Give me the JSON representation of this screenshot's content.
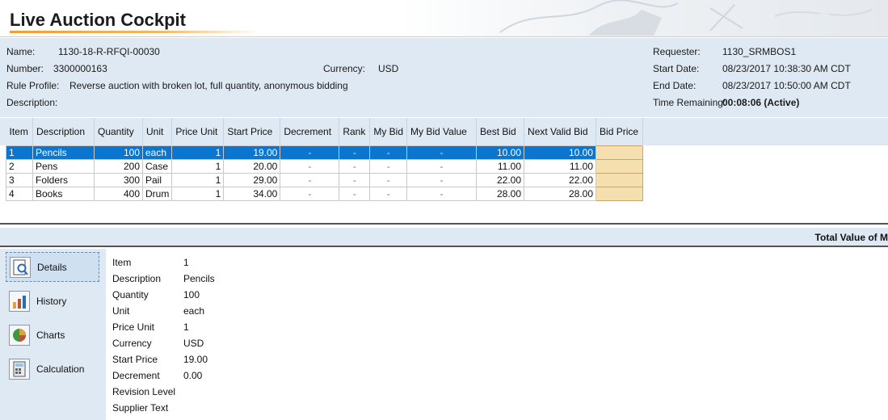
{
  "app": {
    "title": "Live Auction Cockpit"
  },
  "header": {
    "name_label": "Name:",
    "name_value": "1130-18-R-RFQI-00030",
    "number_label": "Number:",
    "number_value": "3300000163",
    "currency_label": "Currency:",
    "currency_value": "USD",
    "rule_label": "Rule Profile:",
    "rule_value": "Reverse auction with broken lot, full quantity, anonymous bidding",
    "description_label": "Description:",
    "requester_label": "Requester:",
    "requester_value": "1130_SRMBOS1",
    "start_label": "Start Date:",
    "start_value": "08/23/2017 10:38:30 AM CDT",
    "end_label": "End Date:",
    "end_value": "08/23/2017 10:50:00 AM CDT",
    "remaining_label": "Time Remaining:",
    "remaining_value": "00:08:06 (Active)"
  },
  "table": {
    "columns": [
      "Item",
      "Description",
      "Quantity",
      "Unit",
      "Price Unit",
      "Start Price",
      "Decrement",
      "Rank",
      "My Bid",
      "My Bid Value",
      "Best Bid",
      "Next Valid Bid",
      "Bid Price"
    ],
    "rows": [
      [
        "1",
        "Pencils",
        "100",
        "each",
        "1",
        "19.00",
        "-",
        "-",
        "-",
        "-",
        "10.00",
        "10.00",
        ""
      ],
      [
        "2",
        "Pens",
        "200",
        "Case",
        "1",
        "20.00",
        "-",
        "-",
        "-",
        "-",
        "11.00",
        "11.00",
        ""
      ],
      [
        "3",
        "Folders",
        "300",
        "Pail",
        "1",
        "29.00",
        "-",
        "-",
        "-",
        "-",
        "22.00",
        "22.00",
        ""
      ],
      [
        "4",
        "Books",
        "400",
        "Drum",
        "1",
        "34.00",
        "-",
        "-",
        "-",
        "-",
        "28.00",
        "28.00",
        ""
      ]
    ],
    "selected_row": 0
  },
  "total": {
    "label": "Total Value of M"
  },
  "nav": [
    {
      "label": "Details",
      "icon": "details-icon",
      "active": true
    },
    {
      "label": "History",
      "icon": "history-icon",
      "active": false
    },
    {
      "label": "Charts",
      "icon": "charts-icon",
      "active": false
    },
    {
      "label": "Calculation",
      "icon": "calculation-icon",
      "active": false
    }
  ],
  "details": [
    {
      "label": "Item",
      "value": "1"
    },
    {
      "label": "Description",
      "value": "Pencils"
    },
    {
      "label": "Quantity",
      "value": "100"
    },
    {
      "label": "Unit",
      "value": "each"
    },
    {
      "label": "Price Unit",
      "value": "1"
    },
    {
      "label": "Currency",
      "value": "USD"
    },
    {
      "label": "Start Price",
      "value": "19.00"
    },
    {
      "label": "Decrement",
      "value": "0.00"
    },
    {
      "label": "Revision Level",
      "value": ""
    },
    {
      "label": "Supplier Text",
      "value": ""
    }
  ],
  "colors": {
    "selection": "#0a76d0",
    "panel": "#dfe9f3",
    "bid_cell": "#f6dfae",
    "accent": "#f0a030"
  }
}
